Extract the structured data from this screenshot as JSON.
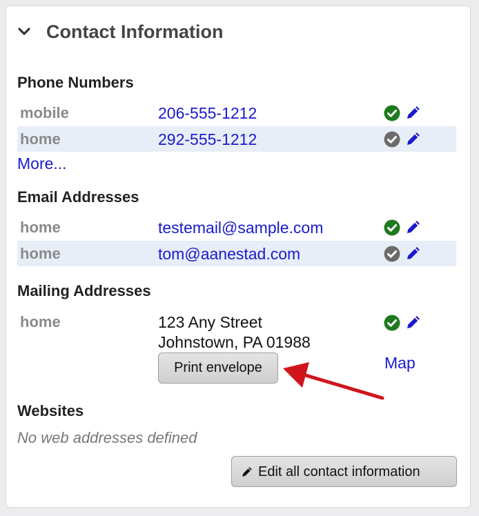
{
  "panel": {
    "title": "Contact Information"
  },
  "phone": {
    "section_title": "Phone Numbers",
    "items": [
      {
        "type": "mobile",
        "value": "206-555-1212",
        "status": "verified"
      },
      {
        "type": "home",
        "value": "292-555-1212",
        "status": "unverified"
      }
    ],
    "more_label": "More..."
  },
  "email": {
    "section_title": "Email Addresses",
    "items": [
      {
        "type": "home",
        "value": "testemail@sample.com",
        "status": "verified"
      },
      {
        "type": "home",
        "value": "tom@aanestad.com",
        "status": "unverified"
      }
    ]
  },
  "mailing": {
    "section_title": "Mailing Addresses",
    "items": [
      {
        "type": "home",
        "line1": "123 Any Street",
        "line2": "Johnstown, PA 01988",
        "status": "verified",
        "print_label": "Print envelope",
        "map_label": "Map"
      }
    ]
  },
  "websites": {
    "section_title": "Websites",
    "empty_text": "No web addresses defined"
  },
  "footer": {
    "edit_all_label": "Edit all contact information"
  },
  "icons": {
    "collapse": "chevron-down-icon",
    "verified": "check-circle-icon",
    "unverified": "check-circle-icon",
    "edit": "pencil-icon"
  },
  "colors": {
    "link": "#1a1acc",
    "verified": "#1e7a1e",
    "unverified": "#6b6b6b",
    "row_shade": "#e8eef7",
    "annotation_arrow": "#d0141c"
  }
}
